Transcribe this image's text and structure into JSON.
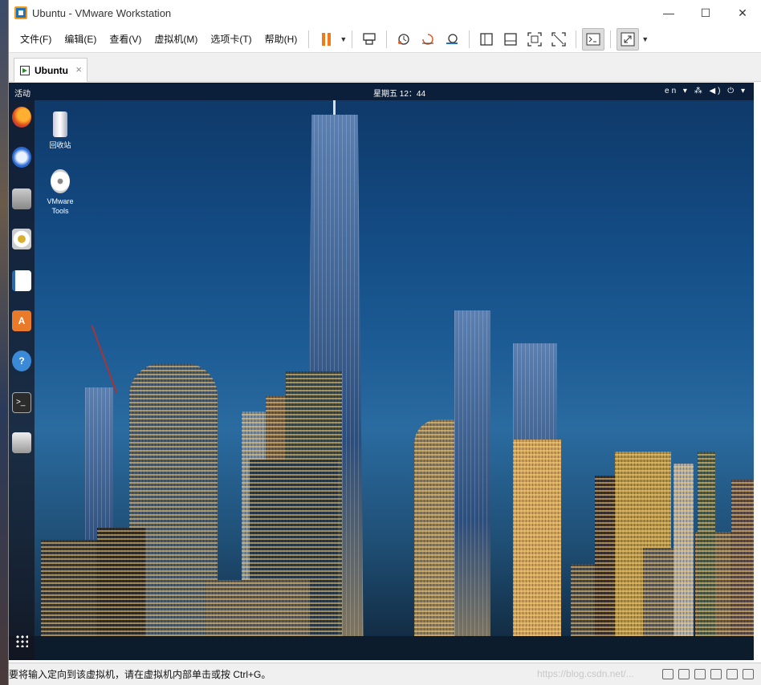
{
  "window": {
    "title": "Ubuntu - VMware Workstation",
    "controls": {
      "minimize": "—",
      "maximize": "☐",
      "close": "✕"
    }
  },
  "menu": {
    "items": [
      "文件(F)",
      "编辑(E)",
      "查看(V)",
      "虚拟机(M)",
      "选项卡(T)",
      "帮助(H)"
    ]
  },
  "toolbar": {
    "icons": [
      "pause-icon",
      "send-ctrl-alt-del-icon",
      "snapshot-icon",
      "revert-snapshot-icon",
      "snapshot-manager-icon",
      "library-view-icon",
      "thumbnail-bar-icon",
      "full-screen-icon",
      "unity-icon",
      "console-view-icon",
      "stretch-guest-icon"
    ]
  },
  "tabs": [
    {
      "label": "Ubuntu",
      "close": "×"
    }
  ],
  "guest": {
    "topbar": {
      "activities": "活动",
      "clock": "星期五 12：44",
      "tray": "en ▾  ⁂ ◀) ⏻ ▾"
    },
    "desktop_icons": [
      {
        "label": "回收站"
      },
      {
        "label_line1": "VMware",
        "label_line2": "Tools"
      }
    ],
    "dock_icons": [
      "firefox-icon",
      "thunderbird-icon",
      "files-icon",
      "rhythmbox-icon",
      "writer-icon",
      "software-icon",
      "help-icon",
      "terminal-icon",
      "optical-drive-icon",
      "show-apps-icon"
    ]
  },
  "statusbar": {
    "message": "要将输入定向到该虚拟机，请在虚拟机内部单击或按 Ctrl+G。",
    "watermark": "https://blog.csdn.net/..."
  },
  "colors": {
    "accent": "#f07a1a",
    "guest_topbar": "#0b1f3a"
  }
}
